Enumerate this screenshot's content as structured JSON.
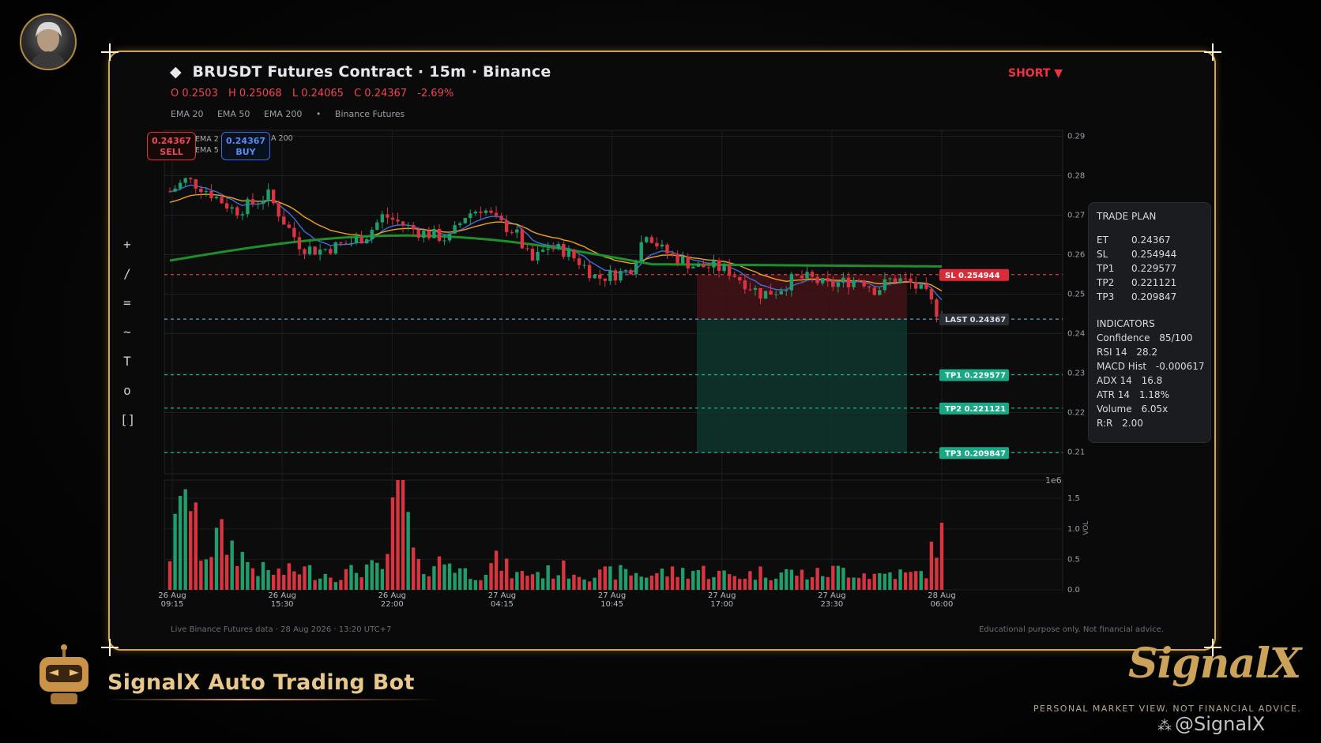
{
  "header": {
    "title": "BRUSDT Futures Contract  ·  15m  ·  Binance",
    "ohlc": {
      "o": "O 0.2503",
      "h": "H 0.25068",
      "l": "L 0.24065",
      "c": "C 0.24367",
      "chg": "-2.69%"
    },
    "indicators_line": [
      "EMA 20",
      "EMA 50",
      "EMA 200",
      "•",
      "Binance Futures"
    ],
    "side_badge": "SHORT ▼"
  },
  "chips": {
    "sell": {
      "price": "0.24367",
      "label": "SELL"
    },
    "buy": {
      "price": "0.24367",
      "label": "BUY"
    }
  },
  "mini_legend": [
    "EMA 2",
    "EMA 5",
    "A 200"
  ],
  "toolbar": [
    "+",
    "/",
    "=",
    "~",
    "T",
    "o",
    "[]"
  ],
  "trade_plan": {
    "title": "TRADE PLAN",
    "levels": [
      {
        "k": "ET",
        "v": "0.24367"
      },
      {
        "k": "SL",
        "v": "0.254944"
      },
      {
        "k": "TP1",
        "v": "0.229577"
      },
      {
        "k": "TP2",
        "v": "0.221121"
      },
      {
        "k": "TP3",
        "v": "0.209847"
      }
    ],
    "indicators_title": "INDICATORS",
    "indicators": [
      {
        "k": "Confidence",
        "v": "85/100"
      },
      {
        "k": "RSI 14",
        "v": "28.2"
      },
      {
        "k": "MACD Hist",
        "v": "-0.000617"
      },
      {
        "k": "ADX 14",
        "v": "16.8"
      },
      {
        "k": "ATR 14",
        "v": "1.18%"
      },
      {
        "k": "Volume",
        "v": "6.05x"
      },
      {
        "k": "R:R",
        "v": "2.00"
      }
    ]
  },
  "level_tags": {
    "sl": "SL  0.254944",
    "last": "LAST  0.24367",
    "tp1": "TP1  0.229577",
    "tp2": "TP2  0.221121",
    "tp3": "TP3  0.209847"
  },
  "footer": {
    "left": "Live Binance Futures data   ·   28 Aug 2026 · 13:20 UTC+7",
    "right": "Educational purpose only. Not financial advice."
  },
  "branding": {
    "bot_name": "SignalX Auto Trading Bot",
    "logo": "SignalX",
    "tagline": "PERSONAL MARKET VIEW. NOT FINANCIAL ADVICE.",
    "watermark": "@SignalX"
  },
  "colors": {
    "gold": "#d4a64a",
    "up": "#1f9d6b",
    "down": "#d9343f",
    "ema20": "#3b6fe0",
    "ema50": "#f0a020",
    "ema200": "#1f8f2a",
    "sl": "#e23a48",
    "tp": "#1fae8a"
  },
  "chart_data": {
    "type": "candlestick",
    "price_axis": {
      "ticks": [
        0.21,
        0.22,
        0.23,
        0.24,
        0.25,
        0.26,
        0.27,
        0.28,
        0.29
      ],
      "range": [
        0.2045,
        0.2915
      ]
    },
    "volume_axis": {
      "ticks": [
        0.0,
        0.5,
        1.0,
        1.5
      ],
      "label": "VOL",
      "multiplier": "1e6",
      "range": [
        0,
        1.8
      ]
    },
    "x_labels": [
      "26 Aug\n09:15",
      "26 Aug\n15:30",
      "26 Aug\n22:00",
      "27 Aug\n04:15",
      "27 Aug\n10:45",
      "27 Aug\n17:00",
      "27 Aug\n23:30",
      "28 Aug\n06:00"
    ],
    "levels": {
      "sl": 0.254944,
      "last": 0.24367,
      "tp1": 0.229577,
      "tp2": 0.221121,
      "tp3": 0.209847
    },
    "close_path": [
      0.276,
      0.279,
      0.277,
      0.274,
      0.271,
      0.273,
      0.275,
      0.268,
      0.262,
      0.261,
      0.262,
      0.263,
      0.265,
      0.27,
      0.268,
      0.266,
      0.265,
      0.264,
      0.27,
      0.272,
      0.268,
      0.266,
      0.258,
      0.262,
      0.261,
      0.258,
      0.254,
      0.255,
      0.256,
      0.266,
      0.261,
      0.259,
      0.257,
      0.257,
      0.256,
      0.253,
      0.25,
      0.251,
      0.254,
      0.254,
      0.252,
      0.253,
      0.254,
      0.251,
      0.254,
      0.253,
      0.25,
      0.24367
    ],
    "volume_shape": [
      0.65,
      1.65,
      0.6,
      0.9,
      0.7,
      0.4,
      0.3,
      0.3,
      0.35,
      0.3,
      0.25,
      0.3,
      0.4,
      0.3,
      1.8,
      0.35,
      0.45,
      0.5,
      0.3,
      0.3,
      0.5,
      0.25,
      0.3,
      0.3,
      0.35,
      0.3,
      0.25,
      0.3,
      0.3,
      0.25,
      0.3,
      0.3,
      0.35,
      0.3,
      0.25,
      0.25,
      0.3,
      0.3,
      0.3,
      0.25,
      0.3,
      0.35,
      0.3,
      0.25,
      0.3,
      0.25,
      0.3,
      1.1
    ]
  }
}
